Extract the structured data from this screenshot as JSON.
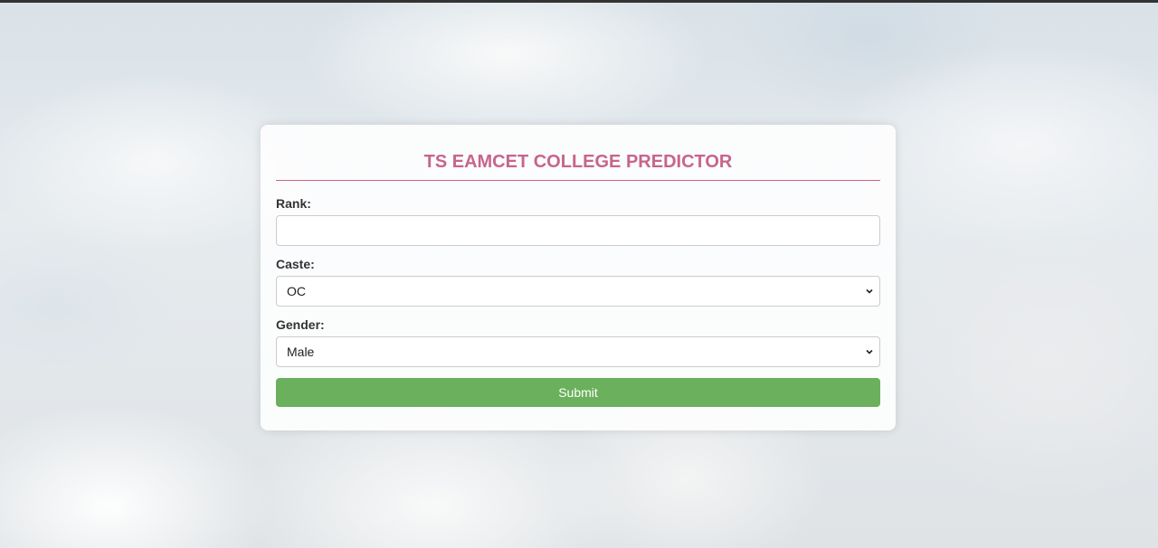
{
  "form": {
    "title": "TS EAMCET COLLEGE PREDICTOR",
    "rank": {
      "label": "Rank:",
      "value": ""
    },
    "caste": {
      "label": "Caste:",
      "selected": "OC"
    },
    "gender": {
      "label": "Gender:",
      "selected": "Male"
    },
    "submit_label": "Submit"
  },
  "colors": {
    "title": "#c7658c",
    "submit_bg": "#6ab05d",
    "top_bar": "#333333"
  },
  "icons": [
    "chevron-down-icon"
  ]
}
